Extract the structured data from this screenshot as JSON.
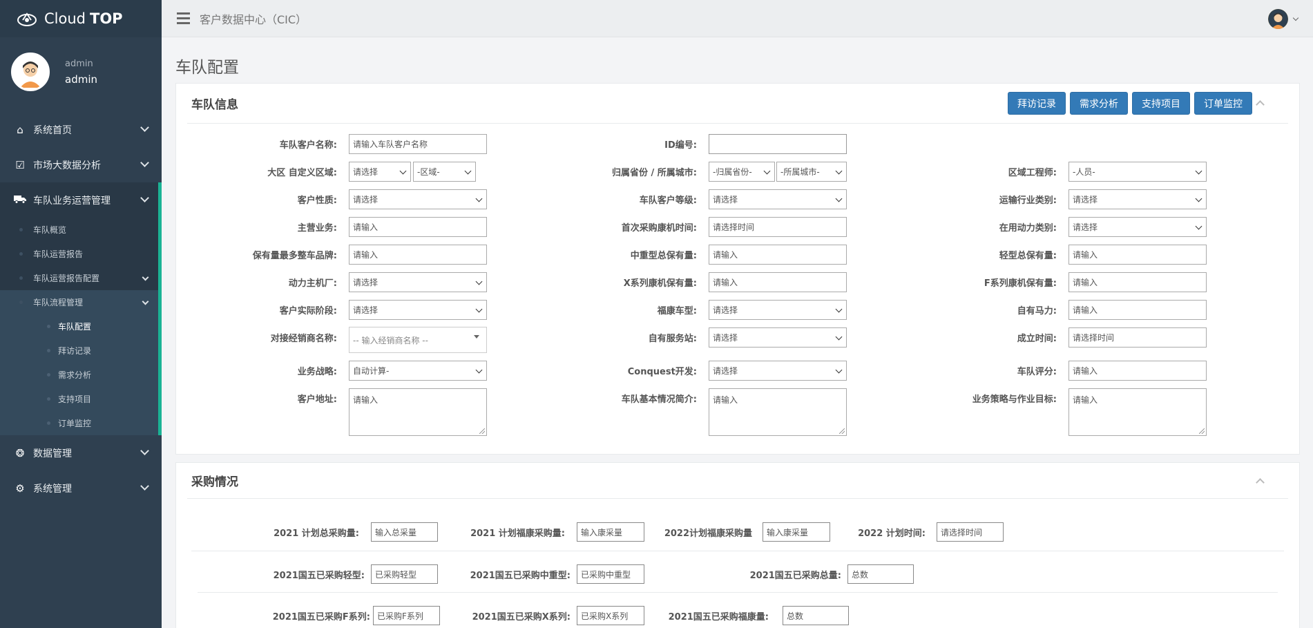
{
  "app": {
    "logo_prefix": "Cloud",
    "logo_bold": "TOP",
    "header_title": "客户数据中心（CIC）"
  },
  "profile": {
    "role": "admin",
    "name": "admin"
  },
  "sidebar": {
    "items": [
      {
        "label": "系统首页",
        "icon": "home-icon"
      },
      {
        "label": "市场大数据分析",
        "icon": "checkbox-icon"
      },
      {
        "label": "车队业务运营管理",
        "icon": "truck-icon"
      },
      {
        "label": "数据管理",
        "icon": "life-ring-icon"
      },
      {
        "label": "系统管理",
        "icon": "cogs-icon"
      }
    ],
    "sub": [
      "车队概览",
      "车队运营报告",
      "车队运营报告配置",
      "车队流程管理"
    ],
    "subsub": [
      "车队配置",
      "拜访记录",
      "需求分析",
      "支持项目",
      "订单监控"
    ]
  },
  "page": {
    "title": "车队配置"
  },
  "fleet_panel": {
    "title": "车队信息",
    "buttons": [
      "拜访记录",
      "需求分析",
      "支持项目",
      "订单监控"
    ],
    "rows": [
      {
        "l1": "车队客户名称:",
        "v1": "请输入车队客户名称",
        "l2": "ID编号:",
        "v2": ""
      },
      {
        "l1": "大区 自定义区域:",
        "v1a": "请选择",
        "v1b": "-区域-",
        "l2": "归属省份 / 所属城市:",
        "v2a": "-归属省份-",
        "v2b": "-所属城市-",
        "l3": "区域工程师:",
        "v3": "-人员-"
      },
      {
        "l1": "客户性质:",
        "v1": "请选择",
        "l2": "车队客户等级:",
        "v2": "请选择",
        "l3": "运输行业类别:",
        "v3": "请选择"
      },
      {
        "l1": "主营业务:",
        "v1": "请输入",
        "l2": "首次采购康机时间:",
        "v2": "请选择时间",
        "l3": "在用动力类别:",
        "v3": "请选择"
      },
      {
        "l1": "保有量最多整车品牌:",
        "v1": "请输入",
        "l2": "中重型总保有量:",
        "v2": "请输入",
        "l3": "轻型总保有量:",
        "v3": "请输入"
      },
      {
        "l1": "动力主机厂:",
        "v1": "请选择",
        "l2": "X系列康机保有量:",
        "v2": "请输入",
        "l3": "F系列康机保有量:",
        "v3": "请输入"
      },
      {
        "l1": "客户实际阶段:",
        "v1": "请选择",
        "l2": "福康车型:",
        "v2": "请选择",
        "l3": "自有马力:",
        "v3": "请输入"
      },
      {
        "l1": "对接经销商名称:",
        "v1": "-- 输入经销商名称 --",
        "l2": "自有服务站:",
        "v2": "请选择",
        "l3": "成立时间:",
        "v3": "请选择时间"
      },
      {
        "l1": "业务战略:",
        "v1": "自动计算-",
        "l2": "Conquest开发:",
        "v2": "请选择",
        "l3": "车队评分:",
        "v3": "请输入"
      },
      {
        "l1": "客户地址:",
        "v1": "请输入",
        "l2": "车队基本情况简介:",
        "v2": "请输入",
        "l3": "业务策略与作业目标:",
        "v3": "请输入"
      }
    ]
  },
  "purchase_panel": {
    "title": "采购情况",
    "row1": [
      {
        "label": "2021 计划总采购量:",
        "value": "输入总采量"
      },
      {
        "label": "2021 计划福康采购量:",
        "value": "输入康采量"
      },
      {
        "label": "2022计划福康采购量",
        "value": "输入康采量"
      },
      {
        "label": "2022 计划时间:",
        "value": "请选择时间"
      }
    ],
    "row2": [
      {
        "label": "2021国五已采购轻型:",
        "value": "已采购轻型"
      },
      {
        "label": "2021国五已采购中重型:",
        "value": "已采购中重型"
      },
      {
        "label": "2021国五已采购总量:",
        "value": "总数"
      }
    ],
    "row3": [
      {
        "label": "2021国五已采购F系列:",
        "value": "已采购F系列"
      },
      {
        "label": "2021国五已采购X系列:",
        "value": "已采购X系列"
      },
      {
        "label": "2021国五已采购福康量:",
        "value": "总数"
      }
    ]
  }
}
